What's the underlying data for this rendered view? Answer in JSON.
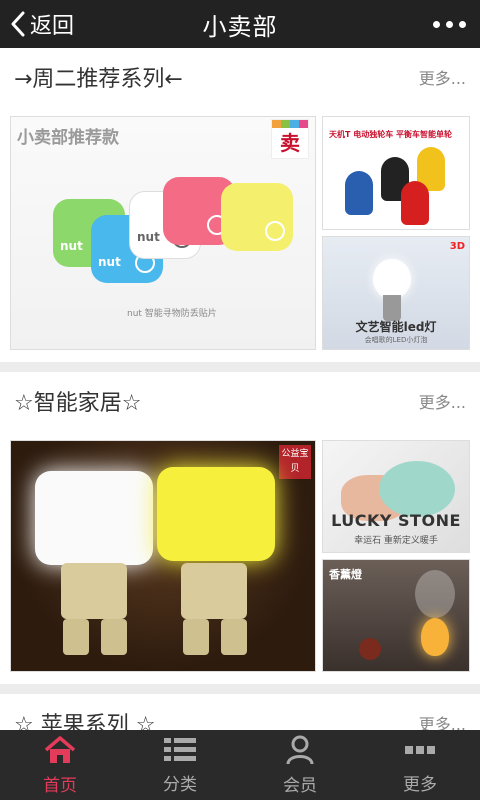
{
  "header": {
    "back_label": "返回",
    "title": "小卖部"
  },
  "sections": [
    {
      "title": "→周二推荐系列←",
      "more": "更多...",
      "big": {
        "caption": "小卖部推荐款",
        "badge": "卖",
        "nut_caption": "nut 智能寻物防丢贴片",
        "nut": "nut"
      },
      "side_top": {
        "caption": "天机T 电动独轮车 平衡车智能单轮"
      },
      "side_bottom": {
        "caption": "文艺智能led灯",
        "caption2": "会唱歌的LED小灯泡",
        "badge": "3D"
      }
    },
    {
      "title": "☆智能家居☆",
      "more": "更多...",
      "big": {
        "badge": "公益宝贝"
      },
      "side_top": {
        "caption": "LUCKY STONE",
        "sub": "幸运石 重新定义暖手"
      },
      "side_bottom": {
        "caption": "香薰燈"
      }
    },
    {
      "title": "☆ 苹果系列 ☆",
      "more": "更多..."
    }
  ],
  "tabs": [
    {
      "label": "首页",
      "icon": "home-icon",
      "active": true
    },
    {
      "label": "分类",
      "icon": "list-icon",
      "active": false
    },
    {
      "label": "会员",
      "icon": "user-icon",
      "active": false
    },
    {
      "label": "更多",
      "icon": "more-icon",
      "active": false
    }
  ],
  "colors": {
    "accent": "#e33b5a",
    "header_bg": "#222222",
    "tabbar_bg": "#2a2a2a"
  }
}
